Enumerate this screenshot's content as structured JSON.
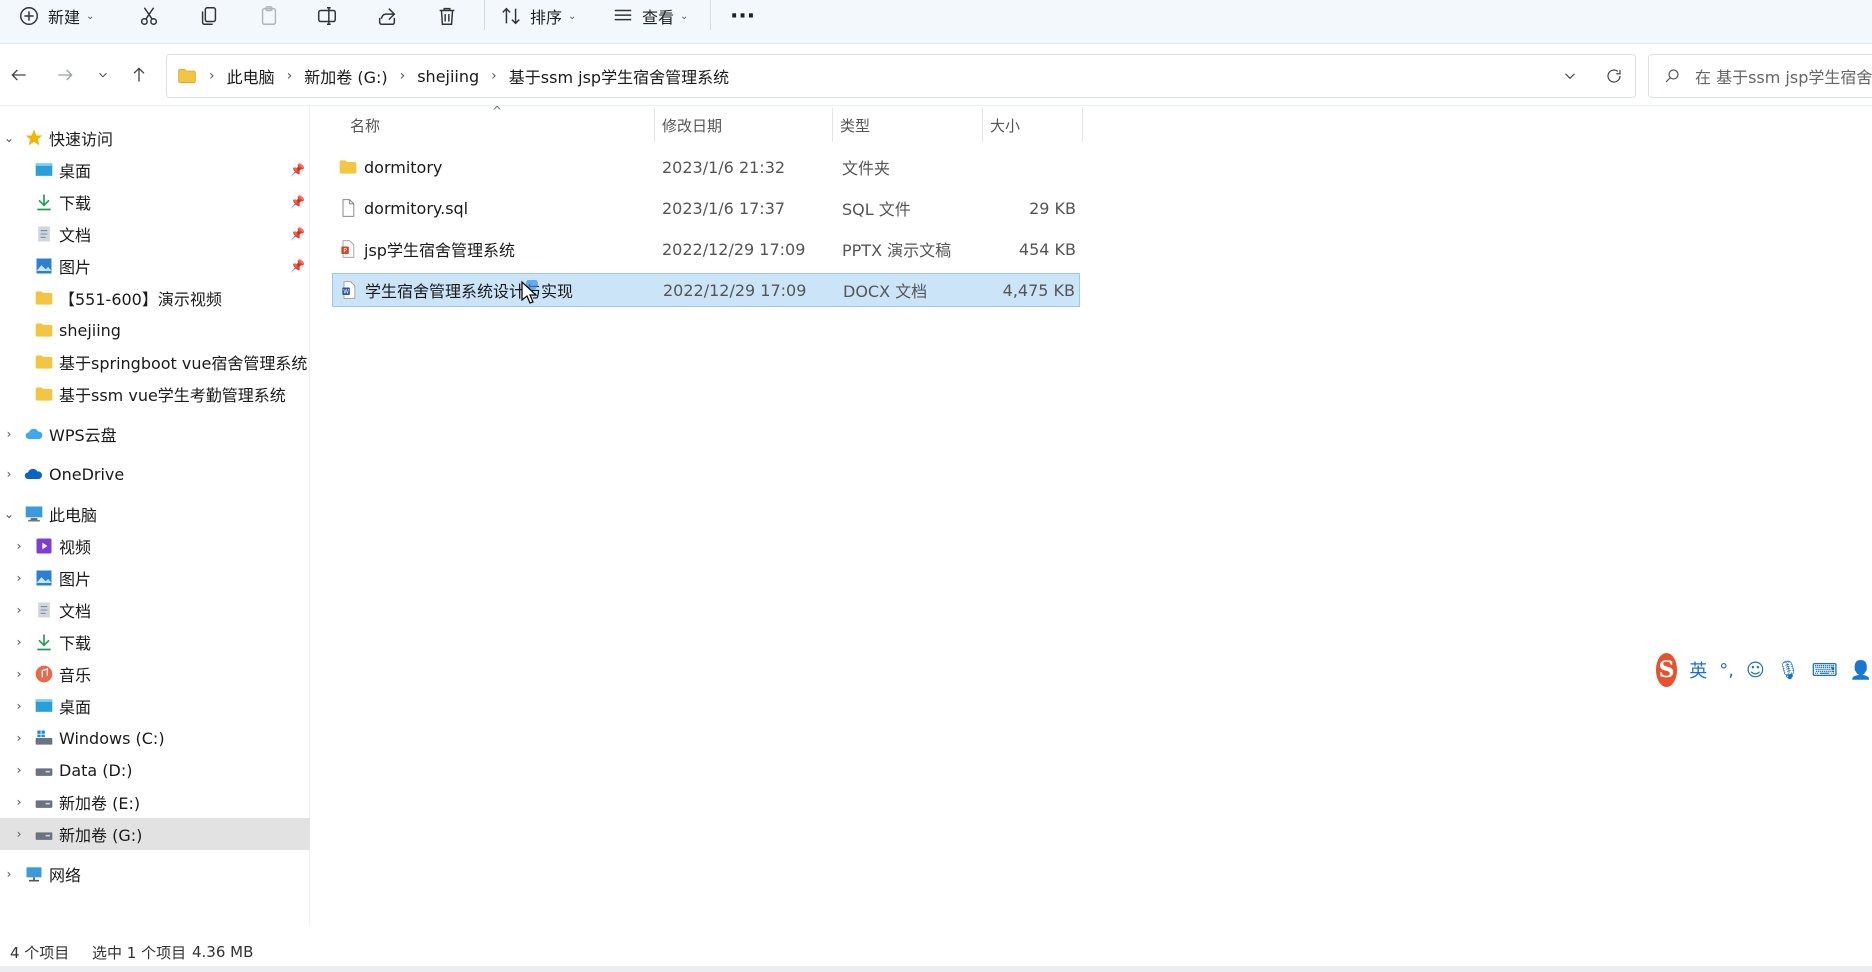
{
  "toolbar": {
    "new_label": "新建",
    "sort_label": "排序",
    "view_label": "查看"
  },
  "breadcrumb": [
    "此电脑",
    "新加卷 (G:)",
    "shejiing",
    "基于ssm jsp学生宿舍管理系统"
  ],
  "search": {
    "placeholder": "在 基于ssm jsp学生宿舍管"
  },
  "sidebar": {
    "quick_access": "快速访问",
    "quick_items": [
      {
        "label": "桌面",
        "icon": "desktop-icon",
        "pinned": true
      },
      {
        "label": "下载",
        "icon": "download-icon",
        "pinned": true
      },
      {
        "label": "文档",
        "icon": "document-icon",
        "pinned": true
      },
      {
        "label": "图片",
        "icon": "pictures-icon",
        "pinned": true
      },
      {
        "label": "【551-600】演示视频",
        "icon": "folder-icon",
        "pinned": false
      },
      {
        "label": "shejiing",
        "icon": "folder-icon",
        "pinned": false
      },
      {
        "label": "基于springboot vue宿舍管理系统",
        "icon": "folder-icon",
        "pinned": false
      },
      {
        "label": "基于ssm vue学生考勤管理系统",
        "icon": "folder-icon",
        "pinned": false
      }
    ],
    "wps": "WPS云盘",
    "onedrive": "OneDrive",
    "this_pc": "此电脑",
    "pc_items": [
      {
        "label": "视频",
        "icon": "video-icon"
      },
      {
        "label": "图片",
        "icon": "pictures-icon"
      },
      {
        "label": "文档",
        "icon": "document-icon"
      },
      {
        "label": "下载",
        "icon": "download-icon"
      },
      {
        "label": "音乐",
        "icon": "music-icon"
      },
      {
        "label": "桌面",
        "icon": "desktop-icon"
      },
      {
        "label": "Windows (C:)",
        "icon": "drive-icon"
      },
      {
        "label": "Data (D:)",
        "icon": "drive-icon"
      },
      {
        "label": "新加卷 (E:)",
        "icon": "drive-icon"
      },
      {
        "label": "新加卷 (G:)",
        "icon": "drive-icon"
      }
    ],
    "network": "网络"
  },
  "columns": {
    "name": "名称",
    "date": "修改日期",
    "type": "类型",
    "size": "大小"
  },
  "files": [
    {
      "name": "dormitory",
      "date": "2023/1/6 21:32",
      "type": "文件夹",
      "size": "",
      "icon": "folder-icon"
    },
    {
      "name": "dormitory.sql",
      "date": "2023/1/6 17:37",
      "type": "SQL 文件",
      "size": "29 KB",
      "icon": "file-icon"
    },
    {
      "name": "jsp学生宿舍管理系统",
      "date": "2022/12/29 17:09",
      "type": "PPTX 演示文稿",
      "size": "454 KB",
      "icon": "pptx-icon"
    },
    {
      "name": "学生宿舍管理系统设计与实现",
      "date": "2022/12/29 17:09",
      "type": "DOCX 文档",
      "size": "4,475 KB",
      "icon": "docx-icon"
    }
  ],
  "status": {
    "count": "4 个项目",
    "selected": "选中 1 个项目",
    "size": "4.36 MB"
  },
  "ime": {
    "mode": "英"
  }
}
